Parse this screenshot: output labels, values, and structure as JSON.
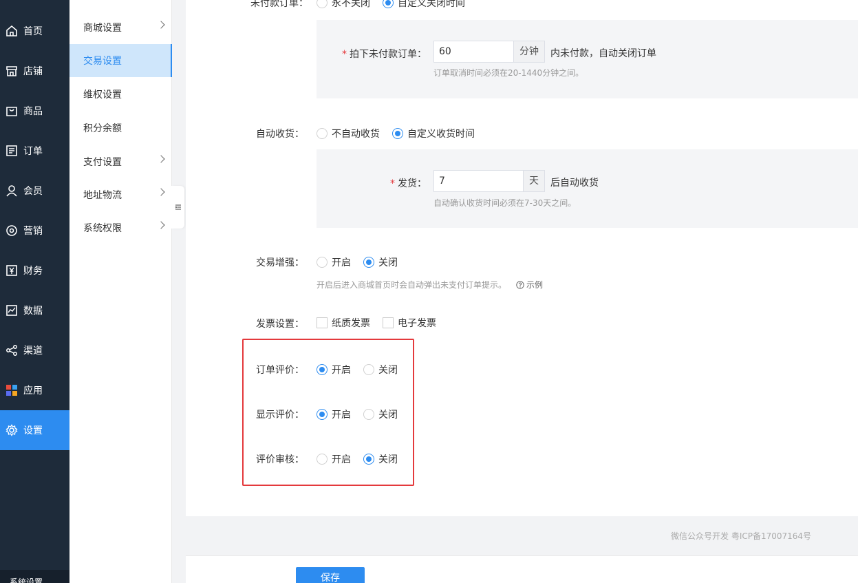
{
  "sidebar": {
    "items": [
      {
        "label": "首页"
      },
      {
        "label": "店铺"
      },
      {
        "label": "商品"
      },
      {
        "label": "订单"
      },
      {
        "label": "会员"
      },
      {
        "label": "营销"
      },
      {
        "label": "财务"
      },
      {
        "label": "数据"
      },
      {
        "label": "渠道"
      },
      {
        "label": "应用"
      },
      {
        "label": "设置"
      }
    ],
    "bottom_label": "系统设置",
    "active_color": "#2d8cf0"
  },
  "submenu": {
    "items": [
      {
        "label": "商城设置"
      },
      {
        "label": "交易设置"
      },
      {
        "label": "维权设置"
      },
      {
        "label": "积分余额"
      },
      {
        "label": "支付设置"
      },
      {
        "label": "地址物流"
      },
      {
        "label": "系统权限"
      }
    ],
    "active": "交易设置"
  },
  "form": {
    "unpaid": {
      "label": "未付款订单：",
      "options": [
        "永不关闭",
        "自定义关闭时间"
      ],
      "selected": "自定义关闭时间",
      "sub_label": "拍下未付款订单：",
      "value": "60",
      "unit": "分钟",
      "suffix": "内未付款，自动关闭订单",
      "hint": "订单取消时间必须在20-1440分钟之间。"
    },
    "auto_receive": {
      "label": "自动收货：",
      "options": [
        "不自动收货",
        "自定义收货时间"
      ],
      "selected": "自定义收货时间",
      "sub_label": "发货：",
      "value": "7",
      "unit": "天",
      "suffix": "后自动收货",
      "hint": "自动确认收货时间必须在7-30天之间。"
    },
    "trade_enhance": {
      "label": "交易增强：",
      "options": [
        "开启",
        "关闭"
      ],
      "selected": "关闭",
      "hint": "开启后进入商城首页时会自动弹出未支付订单提示。",
      "example": "示例"
    },
    "invoice": {
      "label": "发票设置：",
      "options": [
        "纸质发票",
        "电子发票"
      ]
    },
    "order_review": {
      "label": "订单评价：",
      "options": [
        "开启",
        "关闭"
      ],
      "selected": "开启"
    },
    "show_review": {
      "label": "显示评价：",
      "options": [
        "开启",
        "关闭"
      ],
      "selected": "开启"
    },
    "review_audit": {
      "label": "评价审核：",
      "options": [
        "开启",
        "关闭"
      ],
      "selected": "关闭"
    }
  },
  "footer": {
    "text": "微信公众号开发 粤ICP备17007164号"
  },
  "actions": {
    "save_label": "保存"
  }
}
